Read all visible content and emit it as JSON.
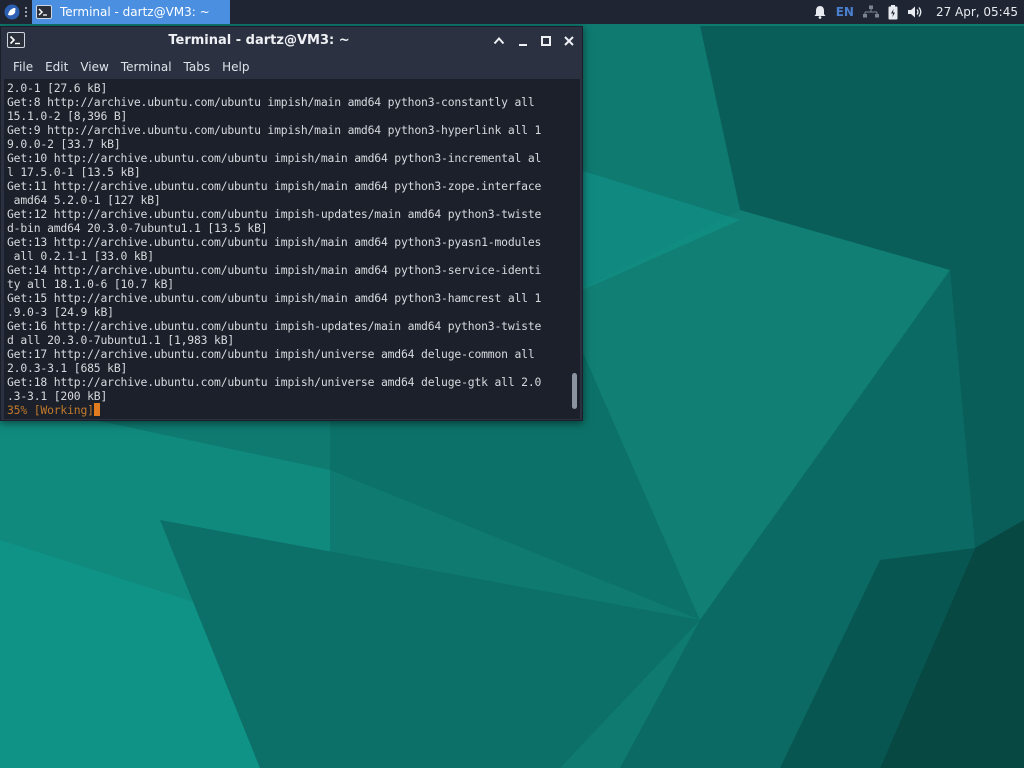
{
  "panel": {
    "menu_icon": "whisker-menu-icon",
    "task_title": "Terminal - dartz@VM3: ~",
    "task_icon": "terminal-icon",
    "tray_icons": [
      "notification-bell-icon",
      "network-icon",
      "battery-icon",
      "volume-icon"
    ],
    "keyboard_layout": "EN",
    "clock": "27 Apr, 05:45"
  },
  "window": {
    "title": "Terminal - dartz@VM3: ~",
    "icon": "terminal-icon",
    "controls": [
      "maximize-up-icon",
      "minimize-icon",
      "maximize-icon",
      "close-icon"
    ]
  },
  "menubar": {
    "items": [
      "File",
      "Edit",
      "View",
      "Terminal",
      "Tabs",
      "Help"
    ]
  },
  "terminal": {
    "lines": [
      "2.0-1 [27.6 kB]",
      "Get:8 http://archive.ubuntu.com/ubuntu impish/main amd64 python3-constantly all",
      "15.1.0-2 [8,396 B]",
      "Get:9 http://archive.ubuntu.com/ubuntu impish/main amd64 python3-hyperlink all 1",
      "9.0.0-2 [33.7 kB]",
      "Get:10 http://archive.ubuntu.com/ubuntu impish/main amd64 python3-incremental al",
      "l 17.5.0-1 [13.5 kB]",
      "Get:11 http://archive.ubuntu.com/ubuntu impish/main amd64 python3-zope.interface",
      " amd64 5.2.0-1 [127 kB]",
      "Get:12 http://archive.ubuntu.com/ubuntu impish-updates/main amd64 python3-twiste",
      "d-bin amd64 20.3.0-7ubuntu1.1 [13.5 kB]",
      "Get:13 http://archive.ubuntu.com/ubuntu impish/main amd64 python3-pyasn1-modules",
      " all 0.2.1-1 [33.0 kB]",
      "Get:14 http://archive.ubuntu.com/ubuntu impish/main amd64 python3-service-identi",
      "ty all 18.1.0-6 [10.7 kB]",
      "Get:15 http://archive.ubuntu.com/ubuntu impish/main amd64 python3-hamcrest all 1",
      ".9.0-3 [24.9 kB]",
      "Get:16 http://archive.ubuntu.com/ubuntu impish-updates/main amd64 python3-twiste",
      "d all 20.3.0-7ubuntu1.1 [1,983 kB]",
      "Get:17 http://archive.ubuntu.com/ubuntu impish/universe amd64 deluge-common all",
      "2.0.3-3.1 [685 kB]",
      "Get:18 http://archive.ubuntu.com/ubuntu impish/universe amd64 deluge-gtk all 2.0",
      ".3-3.1 [200 kB]"
    ],
    "status_line": "35% [Working]"
  },
  "colors": {
    "panel_bg": "#1f2532",
    "task_active": "#4a8fe0",
    "window_bg": "#2b3140",
    "terminal_bg": "#1c202a",
    "terminal_fg": "#d6d9de",
    "status_fg": "#c27a2c",
    "cursor": "#e07b1f",
    "desktop_teal": "#0f7d72"
  }
}
